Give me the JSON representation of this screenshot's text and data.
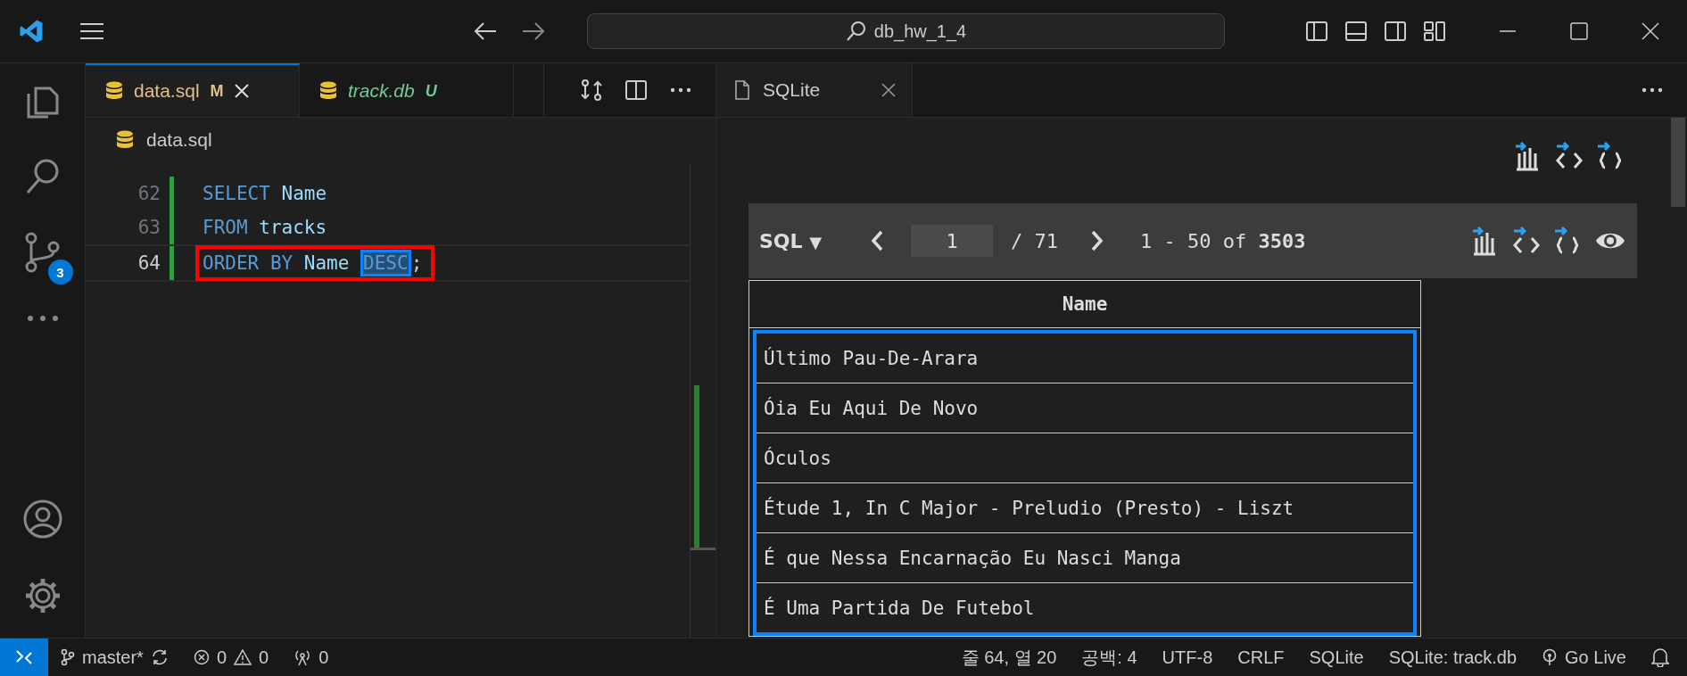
{
  "title_bar": {
    "search": "db_hw_1_4"
  },
  "activity_bar": {
    "source_control_badge": "3"
  },
  "editor": {
    "tabs": [
      {
        "label": "data.sql",
        "status": "M",
        "preview": false,
        "selected": true
      },
      {
        "label": "track.db",
        "status": "U",
        "preview": true,
        "selected": false
      }
    ],
    "breadcrumb": "data.sql",
    "lines": [
      {
        "number": "62",
        "current": false,
        "tokens": [
          {
            "text": "SELECT",
            "kind": "keyword"
          },
          {
            "text": "Name",
            "kind": "ident"
          }
        ]
      },
      {
        "number": "63",
        "current": false,
        "tokens": [
          {
            "text": "FROM",
            "kind": "keyword"
          },
          {
            "text": "tracks",
            "kind": "ident"
          }
        ]
      },
      {
        "number": "64",
        "current": true,
        "tokens": [
          {
            "text": "ORDER",
            "kind": "keyword"
          },
          {
            "text": "BY",
            "kind": "keyword"
          },
          {
            "text": "Name",
            "kind": "ident"
          },
          {
            "text": "DESC",
            "kind": "selected"
          },
          {
            "text": ";",
            "kind": "punct"
          }
        ]
      }
    ]
  },
  "panel": {
    "tabs": [
      {
        "label": "SQLite",
        "selected": true
      }
    ],
    "toolbar": {
      "mode": "SQL",
      "mode_caret": "▼",
      "page": "1",
      "total": "/ 71",
      "range": "1 - 50 of **3503**"
    },
    "table": {
      "columns": [
        "Name"
      ],
      "rows": [
        "Último Pau-De-Arara",
        "Óia Eu Aqui De Novo",
        "Óculos",
        "Étude 1, In C Major - Preludio (Presto) - Liszt",
        "É que Nessa Encarnação Eu Nasci Manga",
        "É Uma Partida De Futebol"
      ]
    }
  },
  "status_bar": {
    "branch": "master*",
    "errors": "0",
    "warnings": "0",
    "ports": "0",
    "items": [
      "줄 64, 열 20",
      "공백: 4",
      "UTF-8",
      "CRLF",
      "SQLite",
      "SQLite: track.db"
    ],
    "go_live": "Go Live"
  }
}
